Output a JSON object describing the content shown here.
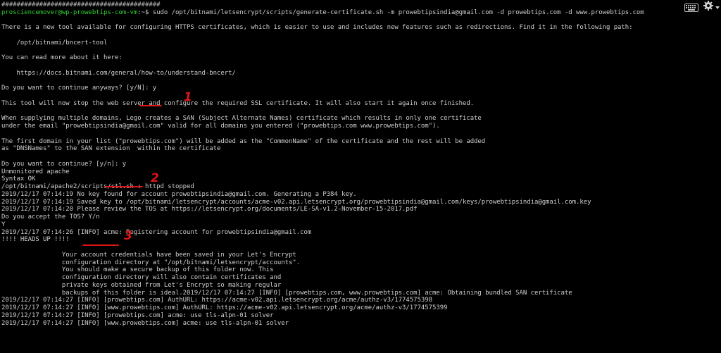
{
  "terminal": {
    "prompt": {
      "user_host": "prosciencemover@wp-prowebtips-com-vm",
      "path_symbol": ":~$",
      "command": " sudo /opt/bitnami/letsencrypt/scripts/generate-certificate.sh -m prowebtipsindia@gmail.com -d prowebtips.com -d www.prowebtips.com"
    },
    "top_line": "##########################################",
    "lines": [
      "",
      "There is a new tool available for configuring HTTPS certificates, which is easier to use and includes new features such as redirections. Find it in the following path:",
      "",
      "    /opt/bitnami/bncert-tool",
      "",
      "You can read more about it here:",
      "",
      "    https://docs.bitnami.com/general/how-to/understand-bncert/",
      "",
      "Do you want to continue anyways? [y/N]: y",
      "",
      "This tool will now stop the web server and configure the required SSL certificate. It will also start it again once finished.",
      "",
      "When supplying multiple domains, Lego creates a SAN (Subject Alternate Names) certificate which results in only one certificate",
      "under the email \"prowebtipsindia@gmail.com\" valid for all domains you entered (\"prowebtips.com www.prowebtips.com\").",
      "",
      "The first domain in your list (\"prowebtips.com\") will be added as the \"CommonName\" of the certificate and the rest will be added",
      "as \"DNSNames\" to the SAN extension  within the certificate",
      "",
      "Do you want to continue? [y/n]: y",
      "Unmonitored apache",
      "Syntax OK",
      "/opt/bitnami/apache2/scripts/ctl.sh : httpd stopped",
      "2019/12/17 07:14:19 No key found for account prowebtipsindia@gmail.com. Generating a P384 key.",
      "2019/12/17 07:14:19 Saved key to /opt/bitnami/letsencrypt/accounts/acme-v02.api.letsencrypt.org/prowebtipsindia@gmail.com/keys/prowebtipsindia@gmail.com.key",
      "2019/12/17 07:14:20 Please review the TOS at https://letsencrypt.org/documents/LE-SA-v1.2-November-15-2017.pdf",
      "Do you accept the TOS? Y/n",
      "Y",
      "2019/12/17 07:14:26 [INFO] acme: Registering account for prowebtipsindia@gmail.com",
      "!!!! HEADS UP !!!!",
      "",
      "                Your account credentials have been saved in your Let's Encrypt",
      "                configuration directory at \"/opt/bitnami/letsencrypt/accounts\".",
      "                You should make a secure backup of this folder now. This",
      "                configuration directory will also contain certificates and",
      "                private keys obtained from Let's Encrypt so making regular",
      "                backups of this folder is ideal.2019/12/17 07:14:27 [INFO] [prowebtips.com, www.prowebtips.com] acme: Obtaining bundled SAN certificate",
      "2019/12/17 07:14:27 [INFO] [prowebtips.com] AuthURL: https://acme-v02.api.letsencrypt.org/acme/authz-v3/1774575398",
      "2019/12/17 07:14:27 [INFO] [www.prowebtips.com] AuthURL: https://acme-v02.api.letsencrypt.org/acme/authz-v3/1774575399",
      "2019/12/17 07:14:27 [INFO] [prowebtips.com] acme: use tls-alpn-01 solver",
      "2019/12/17 07:14:27 [INFO] [www.prowebtips.com] acme: use tls-alpn-01 solver"
    ]
  },
  "annotations": {
    "mark_1": "1",
    "mark_2": "2",
    "mark_3": "3"
  },
  "toolbar": {
    "keyboard_icon": "keyboard-icon",
    "settings_icon": "gear-icon"
  },
  "colors": {
    "background": "#000000",
    "text": "#cfcfcf",
    "prompt_user": "#2fd12f",
    "annotation": "#e01414"
  }
}
